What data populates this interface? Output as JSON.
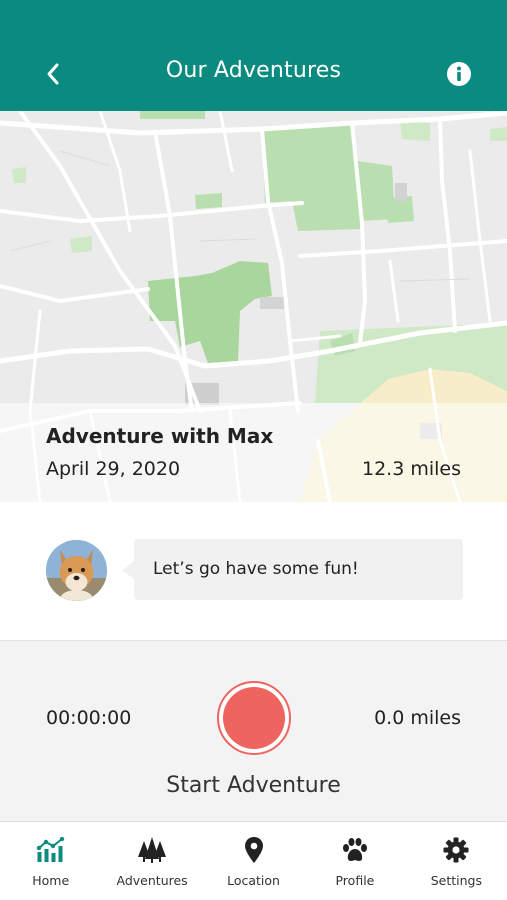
{
  "header": {
    "title": "Our Adventures",
    "back_icon": "chevron-left-icon",
    "info_icon": "info-icon",
    "background": "#0b8b7f"
  },
  "adventure": {
    "title": "Adventure with Max",
    "date": "April 29, 2020",
    "distance": "12.3 miles"
  },
  "message": {
    "avatar": "dog-avatar",
    "text": "Let’s go have some fun!"
  },
  "tracker": {
    "timer": "00:00:00",
    "distance": "0.0 miles",
    "start_label": "Start Adventure",
    "record_color": "#ee6560"
  },
  "nav": {
    "items": [
      {
        "label": "Home",
        "icon": "chart-icon",
        "active": true
      },
      {
        "label": "Adventures",
        "icon": "trees-icon",
        "active": false
      },
      {
        "label": "Location",
        "icon": "location-pin-icon",
        "active": false
      },
      {
        "label": "Profile",
        "icon": "paw-icon",
        "active": false
      },
      {
        "label": "Settings",
        "icon": "gear-icon",
        "active": false
      }
    ],
    "active_color": "#0b8b7f"
  }
}
